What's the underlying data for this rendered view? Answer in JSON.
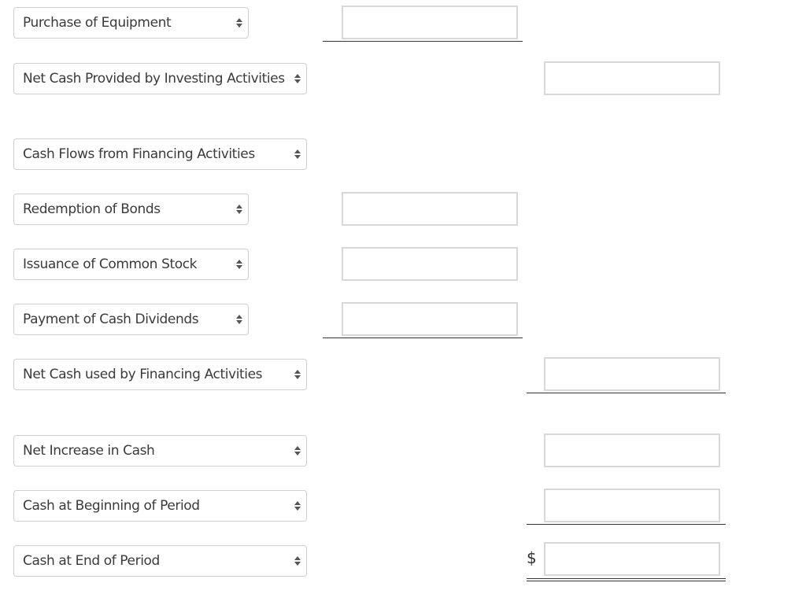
{
  "rows": [
    {
      "label": "Purchase of Equipment",
      "col1_value": ""
    },
    {
      "label": "Net Cash Provided by Investing Activities",
      "col2_value": ""
    },
    {
      "label": "Cash Flows from Financing Activities"
    },
    {
      "label": "Redemption of Bonds",
      "col1_value": ""
    },
    {
      "label": "Issuance of Common Stock",
      "col1_value": ""
    },
    {
      "label": "Payment of Cash Dividends",
      "col1_value": ""
    },
    {
      "label": "Net Cash used by Financing Activities",
      "col2_value": ""
    },
    {
      "label": "Net Increase in Cash",
      "col2_value": ""
    },
    {
      "label": "Cash at Beginning of Period",
      "col2_value": ""
    },
    {
      "label": "Cash at End of Period",
      "col2_value": "",
      "currency_symbol": "$"
    }
  ]
}
